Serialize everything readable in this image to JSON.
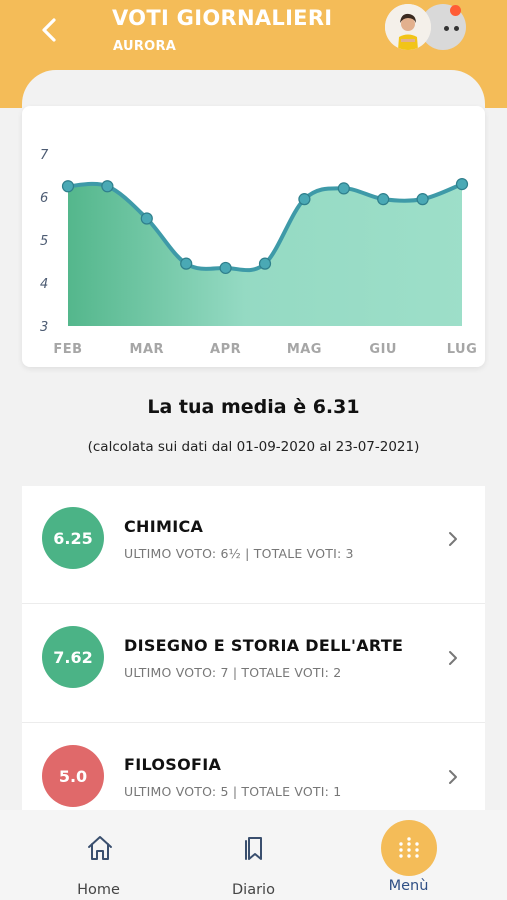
{
  "header": {
    "title": "VOTI GIORNALIERI",
    "subtitle": "AURORA",
    "back_icon": "chevron-left-icon",
    "background_color": "#f4bc58"
  },
  "chart_data": {
    "type": "area",
    "x": [
      "FEB",
      "",
      "MAR",
      "",
      "APR",
      "",
      "MAG",
      "",
      "GIU",
      "",
      "LUG"
    ],
    "categories_shown": [
      "FEB",
      "MAR",
      "APR",
      "MAG",
      "GIU",
      "LUG"
    ],
    "values": [
      6.25,
      6.25,
      5.5,
      4.45,
      4.35,
      4.45,
      5.95,
      6.2,
      5.95,
      5.95,
      6.3
    ],
    "yticks": [
      "7",
      "6",
      "5",
      "4",
      "3"
    ],
    "ylim": [
      3,
      7
    ],
    "grid": false,
    "legend": "none",
    "line_color": "#3e9aa8",
    "fill_color_left": "#4bb386",
    "fill_color_right": "#98ddc6"
  },
  "average": {
    "text": "La tua media è 6.31",
    "calculation_note": "(calcolata sui dati dal 01-09-2020 al 23-07-2021)"
  },
  "subjects": [
    {
      "name": "CHIMICA",
      "average": "6.25",
      "details": "ULTIMO VOTO: 6½  | TOTALE VOTI: 3",
      "color": "#4bb386"
    },
    {
      "name": "DISEGNO E STORIA DELL'ARTE",
      "average": "7.62",
      "details": "ULTIMO VOTO: 7  | TOTALE VOTI: 2",
      "color": "#4bb386"
    },
    {
      "name": "FILOSOFIA",
      "average": "5.0",
      "details": "ULTIMO VOTO: 5  | TOTALE VOTI: 1",
      "color": "#e0696a"
    }
  ],
  "tabs": [
    {
      "label": "Home",
      "icon": "home-icon"
    },
    {
      "label": "Diario",
      "icon": "bookmark-icon"
    },
    {
      "label": "Menù",
      "icon": "dots-grid-icon",
      "active": true
    }
  ]
}
